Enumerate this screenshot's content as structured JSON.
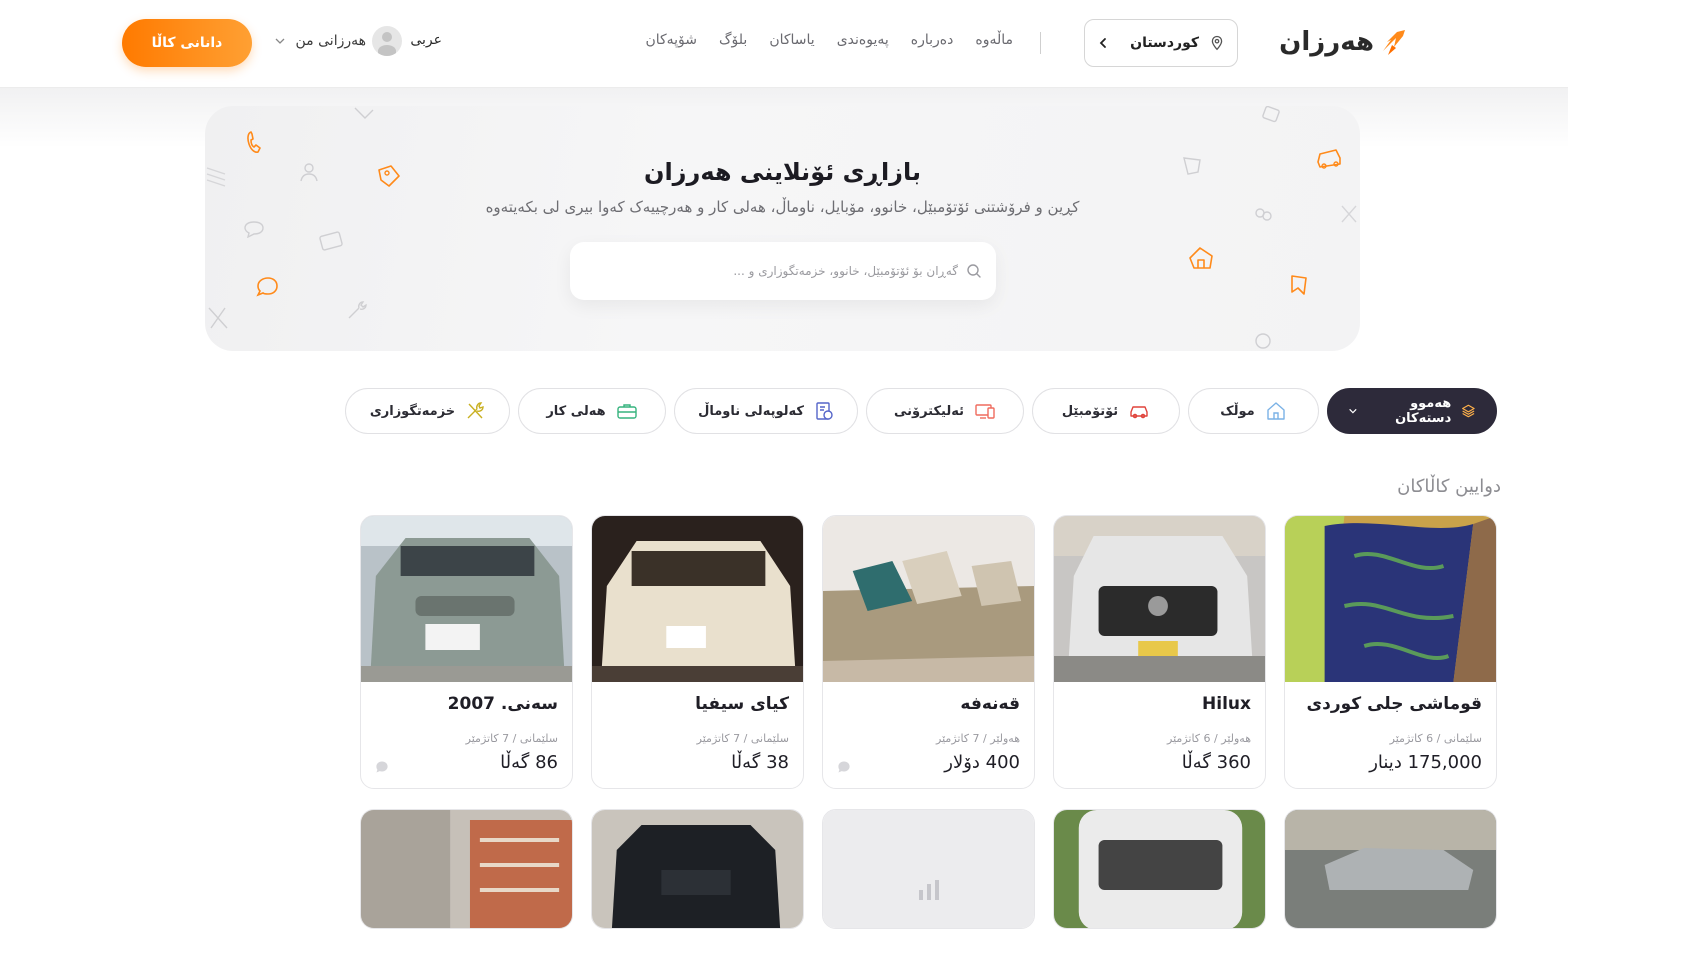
{
  "header": {
    "logo_text": "هەرزان",
    "region_label": "کوردستان",
    "nav": [
      "ماڵەوە",
      "دەربارە",
      "پەیوەندی",
      "یاساکان",
      "بلۆگ",
      "شۆپەکان"
    ],
    "language": "عربی",
    "profile_name": "هەرزانی من",
    "cta_label": "دانانی کاڵا"
  },
  "hero": {
    "title": "بازاڕی ئۆنلاینی هەرزان",
    "subtitle": "کڕین و فرۆشتنی ئۆتۆمبێل، خانوو، مۆبایل، ناوماڵ، هەلی کار و هەرچییەک کەوا بیری لی بکەیتەوە",
    "search_placeholder": "گەڕان بۆ ئۆتۆمبێل، خانوو، خزمەتگوزاری و ..."
  },
  "categories": [
    {
      "label": "هەموو دستەکان",
      "icon": "layers-icon",
      "selected": true
    },
    {
      "label": "موڵک",
      "icon": "house-icon"
    },
    {
      "label": "ئۆتۆمبێل",
      "icon": "car-icon"
    },
    {
      "label": "ئەلیکترۆنی",
      "icon": "devices-icon"
    },
    {
      "label": "کەلوپەلی ناوماڵ",
      "icon": "furniture-icon"
    },
    {
      "label": "هەلی کار",
      "icon": "briefcase-icon"
    },
    {
      "label": "خزمەتگوزاری",
      "icon": "tools-icon"
    }
  ],
  "listings_title": "دوایین کاڵاکان",
  "listings": [
    {
      "title": "قوماشی جلی کوردی",
      "location": "سلێمانی / 6 کاتژمێر",
      "price": "175,000 دینار",
      "chat": false
    },
    {
      "title": "Hilux",
      "location": "هەولێر / 6 کاتژمێر",
      "price": "360 گەڵا",
      "chat": false
    },
    {
      "title": "قەنەفە",
      "location": "هەولێر / 7 کاتژمێر",
      "price": "400 دۆلار",
      "chat": true
    },
    {
      "title": "کیای سیفیا",
      "location": "سلێمانی / 7 کاتژمێر",
      "price": "38 گەڵا",
      "chat": false
    },
    {
      "title": "سەنی. 2007",
      "location": "سلێمانی / 7 کاتژمێر",
      "price": "86 گەڵا",
      "chat": true
    }
  ],
  "colors": {
    "accent": "#ff8a1a",
    "dark": "#2d2a3a"
  }
}
